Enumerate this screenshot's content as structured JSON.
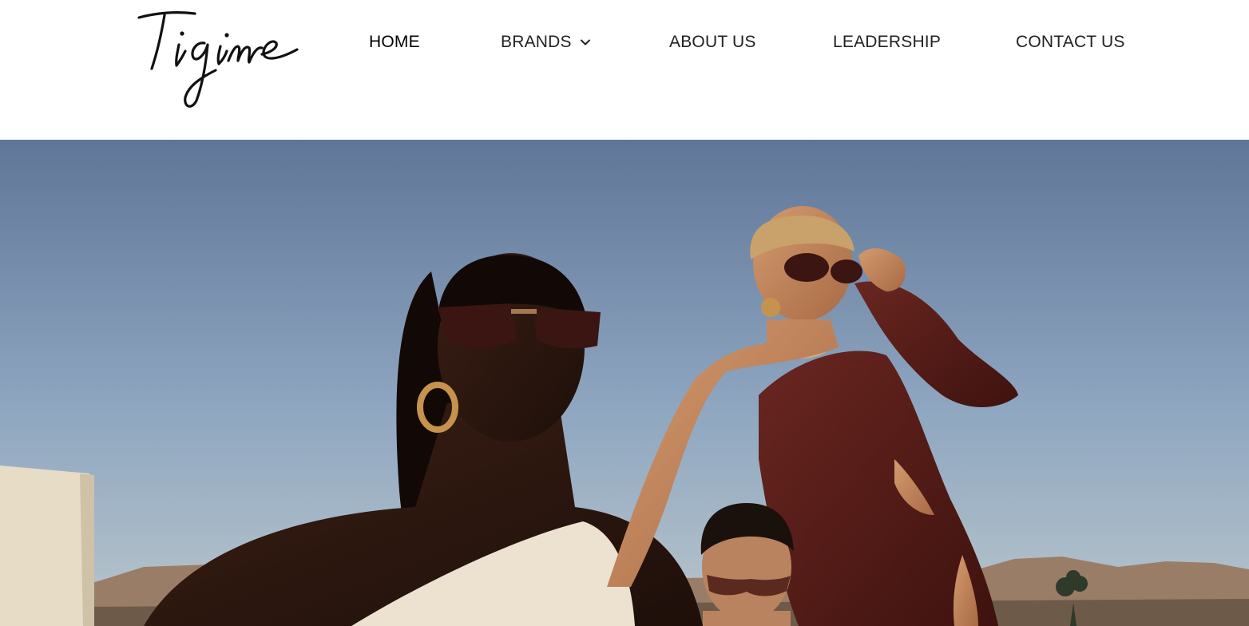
{
  "brand": {
    "logo_text": "Tigime",
    "logo_icon": "tigime-script-logo"
  },
  "nav": {
    "items": [
      {
        "label": "HOME",
        "active": true
      },
      {
        "label": "BRANDS",
        "has_dropdown": true,
        "icon": "chevron-down-icon"
      },
      {
        "label": "ABOUT US"
      },
      {
        "label": "LEADERSHIP"
      },
      {
        "label": "CONTACT US"
      }
    ]
  },
  "hero": {
    "image": "hero-photo",
    "colors": {
      "sky_top": "#5f7698",
      "sky_bottom": "#a9bccb",
      "dress": "#5a1d18",
      "desert": "#9a7d66"
    }
  }
}
